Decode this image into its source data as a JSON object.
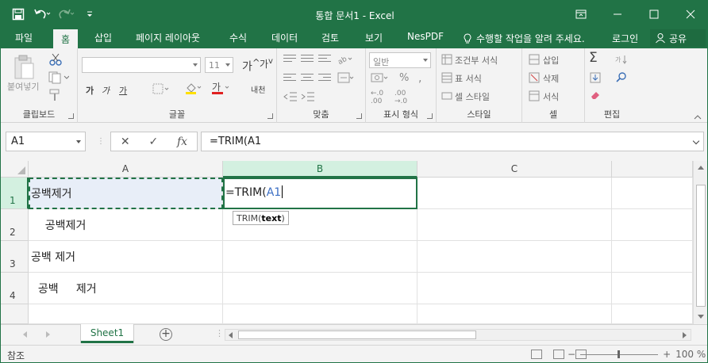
{
  "window": {
    "title": "통합 문서1 - Excel",
    "icons": [
      "save-icon",
      "undo-icon",
      "redo-icon",
      "customize-qat-icon",
      "ribbon-display-icon",
      "minimize-icon",
      "maximize-icon",
      "close-icon"
    ]
  },
  "tabs": [
    "파일",
    "홈",
    "삽입",
    "페이지 레이아웃",
    "수식",
    "데이터",
    "검토",
    "보기",
    "NesPDF"
  ],
  "active_tab": "홈",
  "tellme": "수행할 작업을 알려 주세요.",
  "login": "로그인",
  "share": "공유",
  "ribbon": {
    "clipboard": {
      "label": "클립보드",
      "paste": "붙여넣기"
    },
    "font": {
      "label": "글꼴",
      "size": "11",
      "bold": "가",
      "italic": "가",
      "underline": "가",
      "wrap": "내천"
    },
    "alignment": {
      "label": "맞춤"
    },
    "number": {
      "label": "표시 형식",
      "format": "일반"
    },
    "styles": {
      "label": "스타일",
      "conditional": "조건부 서식",
      "table": "표 서식",
      "cell": "셀 스타일"
    },
    "cells": {
      "label": "셀",
      "insert": "삽입",
      "delete": "삭제",
      "format": "서식"
    },
    "editing": {
      "label": "편집"
    }
  },
  "formula_bar": {
    "name_box": "A1",
    "cancel": "✕",
    "enter": "✓",
    "fx": "fx",
    "formula": "=TRIM(A1"
  },
  "columns": [
    "A",
    "B",
    "C"
  ],
  "rows": [
    "1",
    "2",
    "3",
    "4"
  ],
  "cells": {
    "a1": "공백제거",
    "a2": "    공백제거",
    "a3": "공백 제거",
    "a4": "  공백     제거",
    "b1_prefix": "=TRIM(",
    "b1_ref": "A1"
  },
  "tooltip": {
    "func": "TRIM(",
    "arg": "text",
    "close": ")"
  },
  "sheets": [
    "Sheet1"
  ],
  "status": "참조",
  "zoom": "100 %",
  "colors": {
    "accent": "#217346",
    "ref_blue": "#3c6fc4"
  }
}
